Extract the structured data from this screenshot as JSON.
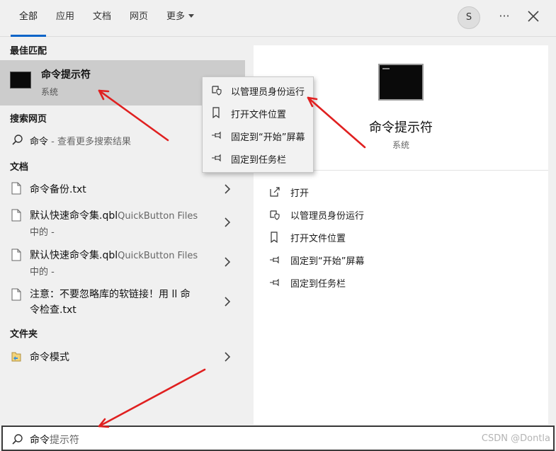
{
  "tabs": [
    {
      "label": "全部",
      "active": true
    },
    {
      "label": "应用",
      "active": false
    },
    {
      "label": "文档",
      "active": false
    },
    {
      "label": "网页",
      "active": false
    },
    {
      "label": "更多",
      "active": false
    }
  ],
  "avatar_letter": "S",
  "more_label": "···",
  "sections": {
    "best_match": "最佳匹配",
    "web": "搜索网页",
    "docs": "文档",
    "folders": "文件夹"
  },
  "best_match": {
    "name": "命令提示符",
    "type": "系统"
  },
  "web_result": {
    "query": "命令",
    "suffix": " - 查看更多搜索结果"
  },
  "documents": [
    {
      "name": "命令备份.txt"
    },
    {
      "name": "默认快速命令集.qbl",
      "location": "QuickButton Files",
      "line2": "中的 -"
    },
    {
      "name": "默认快速命令集.qbl",
      "location": "QuickButton Files",
      "line2": "中的 -"
    },
    {
      "name": "注意：不要忽略库的软链接！用 ll 命",
      "line2": "令检查.txt"
    }
  ],
  "folder": {
    "name": "命令模式"
  },
  "context_menu": [
    {
      "label": "以管理员身份运行",
      "icon": "shield-icon"
    },
    {
      "label": "打开文件位置",
      "icon": "file-location-icon"
    },
    {
      "label": "固定到“开始”屏幕",
      "icon": "pin-icon"
    },
    {
      "label": "固定到任务栏",
      "icon": "pin-icon"
    }
  ],
  "preview": {
    "title": "命令提示符",
    "subtitle": "系统",
    "actions": [
      {
        "label": "打开",
        "icon": "open-icon"
      },
      {
        "label": "以管理员身份运行",
        "icon": "shield-icon"
      },
      {
        "label": "打开文件位置",
        "icon": "file-location-icon"
      },
      {
        "label": "固定到“开始”屏幕",
        "icon": "pin-icon"
      },
      {
        "label": "固定到任务栏",
        "icon": "pin-icon"
      }
    ]
  },
  "search": {
    "typed": "命令",
    "hint": "提示符"
  },
  "watermark": "CSDN @Dontla",
  "colors": {
    "accent": "#0a64c8",
    "annotation_arrow": "#e02020",
    "selected_row": "#cccccc"
  }
}
